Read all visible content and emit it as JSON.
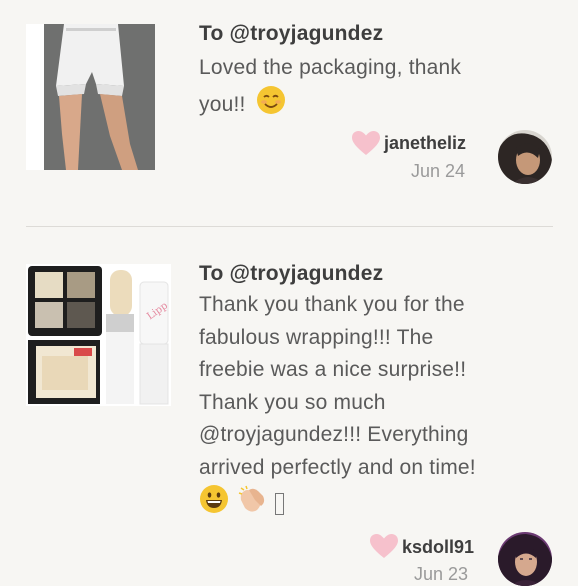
{
  "reviews": [
    {
      "recipient": "To @troyjagundez",
      "message_lines": [
        "Loved the packaging, thank",
        "you!!"
      ],
      "emoji": [
        "smiling-face"
      ],
      "username": "janetheliz",
      "date": "Jun 24"
    },
    {
      "recipient": "To @troyjagundez",
      "message_lines": [
        "Thank you thank you for the",
        "fabulous wrapping!!! The",
        "freebie was a nice surprise!!",
        "Thank you so much",
        "@troyjagundez!!! Everything",
        "arrived perfectly and on time!"
      ],
      "emoji": [
        "grinning-face",
        "clapping-hands",
        "missing-glyph"
      ],
      "username": "ksdoll91",
      "date": "Jun 23"
    }
  ],
  "colors": {
    "background": "#f7f6f3",
    "heart": "#f6c1cc",
    "emoji_yellow": "#f5c531"
  }
}
